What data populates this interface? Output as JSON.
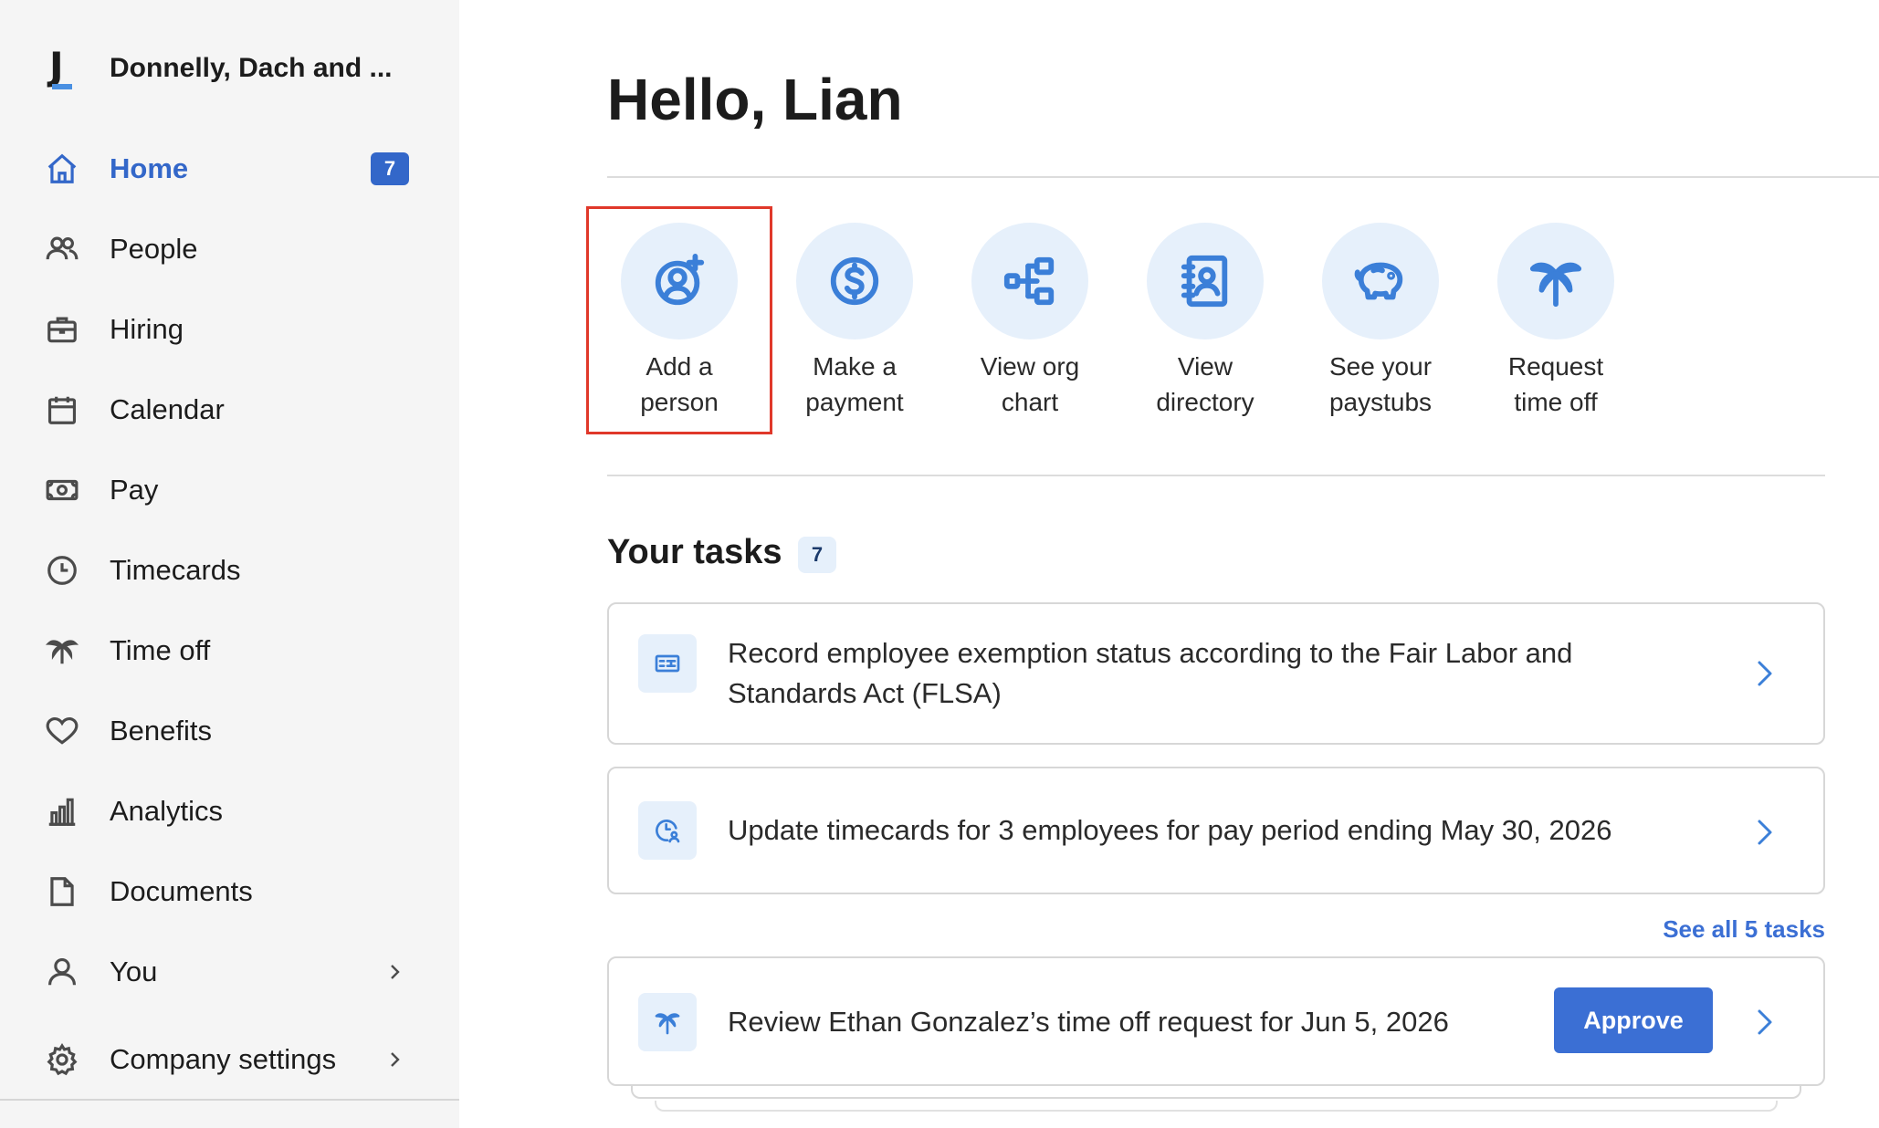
{
  "company": {
    "logo_letter": "J",
    "name": "Donnelly, Dach and ..."
  },
  "nav": {
    "home": {
      "label": "Home",
      "badge": "7",
      "icon": "home-icon"
    },
    "people": {
      "label": "People",
      "icon": "people-icon"
    },
    "hiring": {
      "label": "Hiring",
      "icon": "briefcase-icon"
    },
    "calendar": {
      "label": "Calendar",
      "icon": "calendar-icon"
    },
    "pay": {
      "label": "Pay",
      "icon": "cash-icon"
    },
    "timecards": {
      "label": "Timecards",
      "icon": "clock-icon"
    },
    "timeoff": {
      "label": "Time off",
      "icon": "palm-tree-icon"
    },
    "benefits": {
      "label": "Benefits",
      "icon": "heart-icon"
    },
    "analytics": {
      "label": "Analytics",
      "icon": "bar-chart-icon"
    },
    "documents": {
      "label": "Documents",
      "icon": "document-icon"
    },
    "you": {
      "label": "You",
      "icon": "user-icon"
    },
    "settings": {
      "label": "Company settings",
      "icon": "gear-icon"
    }
  },
  "greeting": "Hello, Lian",
  "quick_actions": [
    {
      "line1": "Add a",
      "line2": "person",
      "icon": "add-person-icon"
    },
    {
      "line1": "Make a",
      "line2": "payment",
      "icon": "dollar-icon"
    },
    {
      "line1": "View org",
      "line2": "chart",
      "icon": "org-chart-icon"
    },
    {
      "line1": "View",
      "line2": "directory",
      "icon": "directory-icon"
    },
    {
      "line1": "See your",
      "line2": "paystubs",
      "icon": "piggy-bank-icon"
    },
    {
      "line1": "Request",
      "line2": "time off",
      "icon": "palm-tree-icon"
    }
  ],
  "tasks": {
    "title": "Your tasks",
    "count": "7",
    "items": [
      {
        "line1": "Record employee exemption status according to the Fair Labor and",
        "line2": "Standards Act (FLSA)",
        "icon": "pay-form-icon"
      },
      {
        "text": "Update timecards for 3 employees for pay period ending May 30, 2026",
        "icon": "clock-person-icon"
      }
    ],
    "see_all": "See all 5 tasks",
    "approval": {
      "text": "Review Ethan Gonzalez’s time off request for Jun 5, 2026",
      "button": "Approve",
      "icon": "palm-tree-icon"
    }
  },
  "colors": {
    "accent": "#3367c9",
    "highlight": "#e0382a",
    "icon_bg": "#e6f0fb"
  }
}
